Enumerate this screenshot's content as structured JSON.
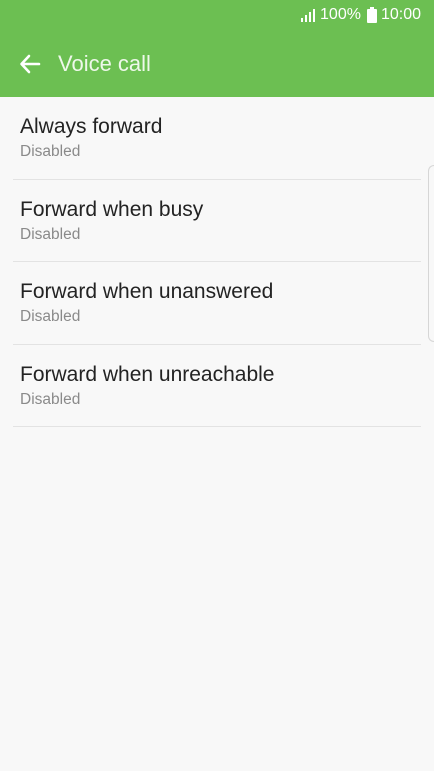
{
  "status_bar": {
    "battery_percent": "100%",
    "time": "10:00"
  },
  "header": {
    "title": "Voice call",
    "back_icon": "arrow-left-icon",
    "color": "#6cbf52"
  },
  "list": {
    "items": [
      {
        "title": "Always forward",
        "status": "Disabled"
      },
      {
        "title": "Forward when busy",
        "status": "Disabled"
      },
      {
        "title": "Forward when unanswered",
        "status": "Disabled"
      },
      {
        "title": "Forward when unreachable",
        "status": "Disabled"
      }
    ]
  }
}
